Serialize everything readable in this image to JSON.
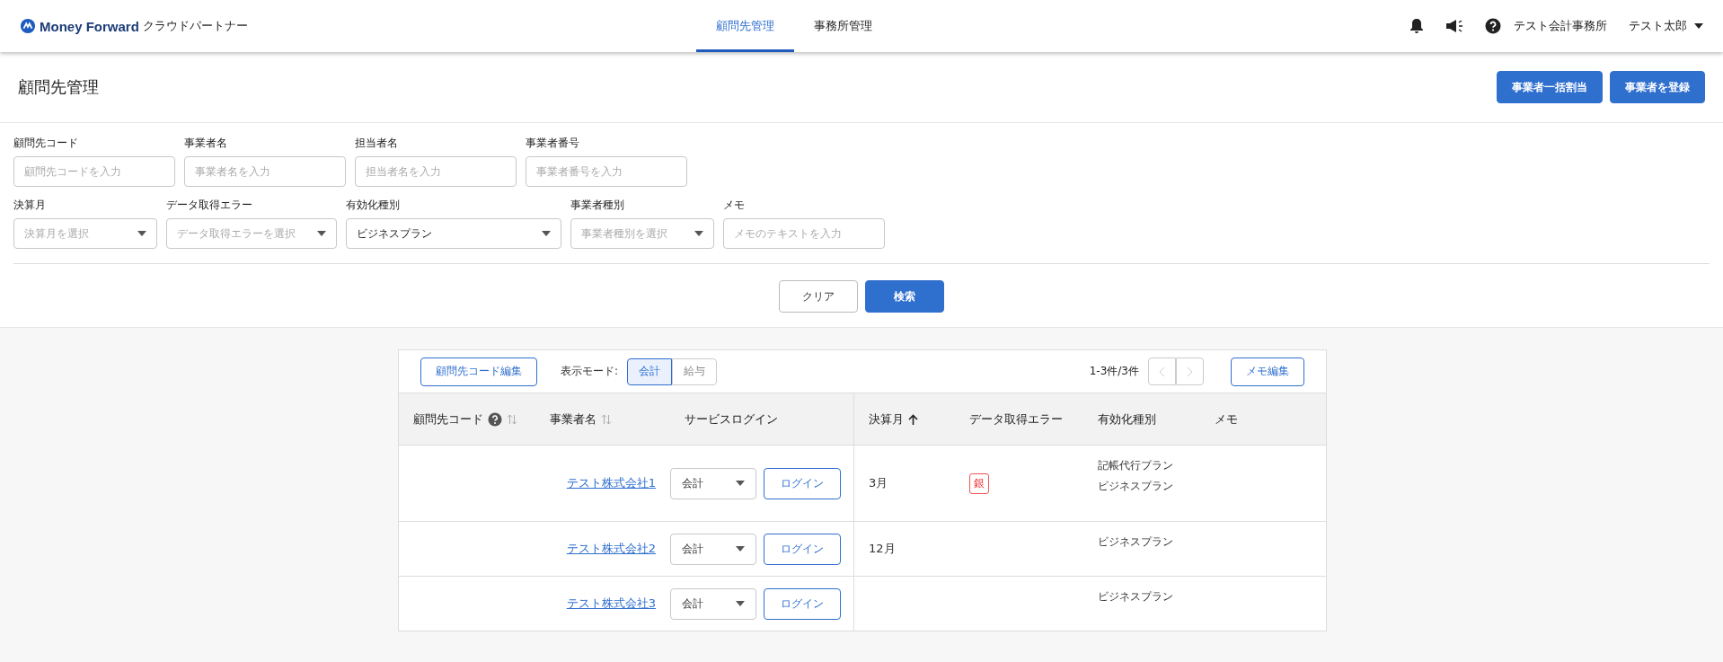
{
  "header": {
    "logo": {
      "brand": "Money Forward",
      "product": "クラウドパートナー"
    },
    "nav": [
      {
        "label": "顧問先管理",
        "selected": true
      },
      {
        "label": "事務所管理",
        "selected": false
      }
    ],
    "office": "テスト会計事務所",
    "user": "テスト太郎"
  },
  "page": {
    "title": "顧問先管理",
    "actions": [
      "事業者一括割当",
      "事業者を登録"
    ]
  },
  "filters": [
    [
      {
        "kind": "text",
        "label": "顧問先コード",
        "placeholder": "顧問先コードを入力"
      },
      {
        "kind": "text",
        "label": "事業者名",
        "placeholder": "事業者名を入力"
      },
      {
        "kind": "text",
        "label": "担当者名",
        "placeholder": "担当者名を入力"
      },
      {
        "kind": "text",
        "label": "事業者番号",
        "placeholder": "事業者番号を入力"
      }
    ],
    [
      {
        "kind": "select",
        "label": "決算月",
        "placeholder": "決算月を選択"
      },
      {
        "kind": "select",
        "label": "データ取得エラー",
        "placeholder": "データ取得エラーを選択"
      },
      {
        "kind": "select",
        "label": "有効化種別",
        "value": "ビジネスプラン"
      },
      {
        "kind": "select",
        "label": "事業者種別",
        "placeholder": "事業者種別を選択"
      },
      {
        "kind": "text",
        "label": "メモ",
        "placeholder": "メモのテキストを入力"
      }
    ]
  ],
  "filter_buttons": {
    "clear": "クリア",
    "search": "検索"
  },
  "table": {
    "code_edit": "顧問先コード編集",
    "mode_label": "表示モード:",
    "modes": [
      {
        "label": "会計",
        "selected": true
      },
      {
        "label": "給与",
        "selected": false
      }
    ],
    "pagination": {
      "range": "1-3件/3件",
      "prev_disabled": true,
      "next_disabled": true
    },
    "memo_edit": "メモ編集",
    "columns": [
      {
        "label": "顧問先コード",
        "kind": "helpsortable"
      },
      {
        "label": "事業者名",
        "kind": "sortable"
      },
      {
        "label": "サービスログイン",
        "kind": "plain"
      },
      {
        "label": "決算月",
        "kind": "ascending"
      },
      {
        "label": "データ取得エラー",
        "kind": "plain"
      },
      {
        "label": "有効化種別",
        "kind": "plain"
      },
      {
        "label": "メモ",
        "kind": "plain"
      }
    ],
    "rows": [
      {
        "name": "テスト株式会社1",
        "service": "会計",
        "login": "ログイン",
        "month": "3月",
        "errors": [
          "銀"
        ],
        "plans": [
          "記帳代行プラン",
          "ビジネスプラン"
        ]
      },
      {
        "name": "テスト株式会社2",
        "service": "会計",
        "login": "ログイン",
        "month": "12月",
        "errors": [],
        "plans": [
          "ビジネスプラン"
        ]
      },
      {
        "name": "テスト株式会社3",
        "service": "会計",
        "login": "ログイン",
        "errors": [],
        "plans": [
          "ビジネスプラン"
        ]
      }
    ]
  }
}
